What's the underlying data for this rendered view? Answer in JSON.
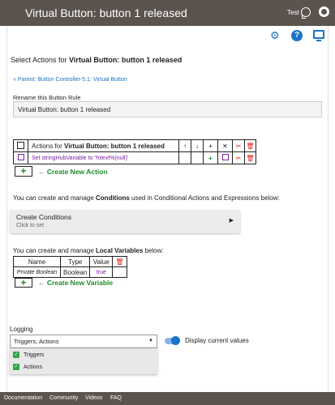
{
  "header": {
    "title": "Virtual Button: button 1 released",
    "user": "Test"
  },
  "page": {
    "select_prefix": "Select Actions for ",
    "select_bold": "Virtual Button: button 1 released",
    "parent_link": "« Parent: Button Controller-5.1: Virtual Button",
    "rename_label": "Rename this Button Rule",
    "rename_value": "Virtual Button: button 1 released"
  },
  "actions_table": {
    "header_prefix": "Actions for ",
    "header_bold": "Virtual Button: button 1 released",
    "col_icons": [
      "↑",
      "↓",
      "+",
      "✕",
      "✂",
      "🗑"
    ],
    "rows": [
      {
        "text": "Set stringHubVariable to '%text%(null)'"
      }
    ],
    "add_symbol": "+",
    "create_link": "← Create New Action"
  },
  "conditions": {
    "text_prefix": "You can create and manage ",
    "text_bold": "Conditions",
    "text_suffix": " used in Conditional Actions and Expressions below:",
    "button_label": "Create Conditions",
    "button_sub": "Click to set",
    "button_arrow": "▶"
  },
  "variables": {
    "text_prefix": "You can create and manage ",
    "text_bold": "Local Variables",
    "text_suffix": " below:",
    "headers": [
      "Name",
      "Type",
      "Value"
    ],
    "rows": [
      {
        "name": "Private Boolean",
        "type": "Boolean",
        "value": "true"
      }
    ],
    "add_symbol": "+",
    "create_link": "← Create New Variable"
  },
  "logging": {
    "label": "Logging",
    "selected": "Triggers, Actions",
    "caret": "▼",
    "options": [
      {
        "label": "Triggers",
        "checked": true
      },
      {
        "label": "Actions",
        "checked": true
      }
    ],
    "checkmark": "✓",
    "toggle_label": "Display current values",
    "toggle_on": true
  },
  "footer": {
    "links": [
      "Documentation",
      "Community",
      "Videos",
      "FAQ"
    ]
  },
  "colors": {
    "header_bg": "#5b534e",
    "accent": "#1a73c8",
    "green": "#1e8b2c",
    "purple": "#7a1fa2",
    "red": "#d22222"
  },
  "icons": [
    "chat-icon",
    "gear-icon",
    "settings-icon",
    "help-icon",
    "monitor-icon",
    "copy-icon",
    "scissors-icon",
    "trash-icon"
  ]
}
